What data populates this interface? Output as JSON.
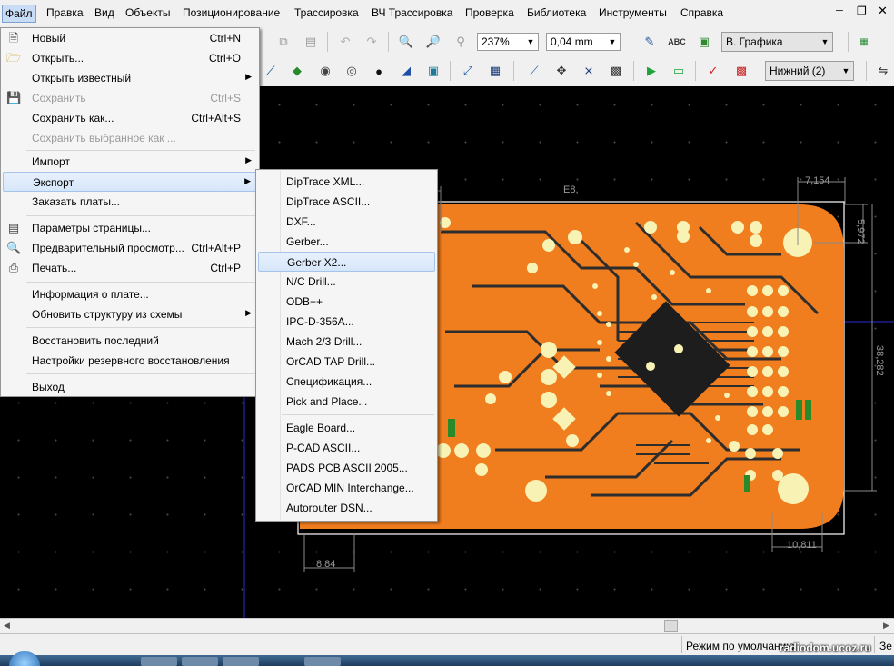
{
  "menubar": {
    "items": [
      "Файл",
      "Правка",
      "Вид",
      "Объекты",
      "Позиционирование",
      "Трассировка",
      "ВЧ Трассировка",
      "Проверка",
      "Библиотека",
      "Инструменты",
      "Справка"
    ]
  },
  "toolbar": {
    "zoom": "237%",
    "grid": "0,04 mm",
    "text_icon": "ABC",
    "layer_combo": "В. Графика",
    "side_combo": "Нижний (2)"
  },
  "file_menu": {
    "items": [
      {
        "label": "Новый",
        "shortcut": "Ctrl+N",
        "icon": "new-document-icon"
      },
      {
        "label": "Открыть...",
        "shortcut": "Ctrl+O",
        "icon": "open-folder-icon"
      },
      {
        "label": "Открыть известный",
        "submenu": true
      },
      {
        "label": "Сохранить",
        "shortcut": "Ctrl+S",
        "disabled": true,
        "icon": "save-icon"
      },
      {
        "label": "Сохранить как...",
        "shortcut": "Ctrl+Alt+S"
      },
      {
        "label": "Сохранить выбранное как ...",
        "disabled": true
      },
      {
        "label": "Импорт",
        "submenu": true
      },
      {
        "label": "Экспорт",
        "submenu": true,
        "highlighted": true
      },
      {
        "label": "Заказать платы..."
      },
      {
        "label": "Параметры страницы...",
        "icon": "page-setup-icon"
      },
      {
        "label": "Предварительный просмотр...",
        "shortcut": "Ctrl+Alt+P",
        "icon": "print-preview-icon"
      },
      {
        "label": "Печать...",
        "shortcut": "Ctrl+P",
        "icon": "printer-icon"
      },
      {
        "label": "Информация о плате..."
      },
      {
        "label": "Обновить структуру из схемы",
        "submenu": true
      },
      {
        "label": "Восстановить последний"
      },
      {
        "label": "Настройки резервного восстановления"
      },
      {
        "label": "Выход"
      }
    ]
  },
  "export_menu": {
    "items": [
      "DipTrace XML...",
      "DipTrace ASCII...",
      "DXF...",
      "Gerber...",
      "Gerber X2...",
      "N/C Drill...",
      "ODB++",
      "IPC-D-356A...",
      "Mach 2/3 Drill...",
      "OrCAD TAP Drill...",
      "Спецификация...",
      "Pick and Place...",
      "Eagle Board...",
      "P-CAD ASCII...",
      "PADS PCB ASCII 2005...",
      "OrCAD MIN Interchange...",
      "Autorouter DSN..."
    ],
    "highlighted": "Gerber X2..."
  },
  "board": {
    "dim_top": "7,154",
    "dim_top_left": "E8,",
    "dim_right_top": "5,972",
    "dim_right_mid": "38,282",
    "dim_bottom_right": "10,811",
    "dim_bottom_left": "8,84",
    "colors": {
      "copper_top": "#f07d1e",
      "pad": "#f8f2b4",
      "trace": "#2d2d2d",
      "outline": "#ffffff"
    }
  },
  "status": {
    "mode": "Режим по умолчанию",
    "right": "Зе",
    "watermark": "radiodom.ucoz.ru"
  }
}
